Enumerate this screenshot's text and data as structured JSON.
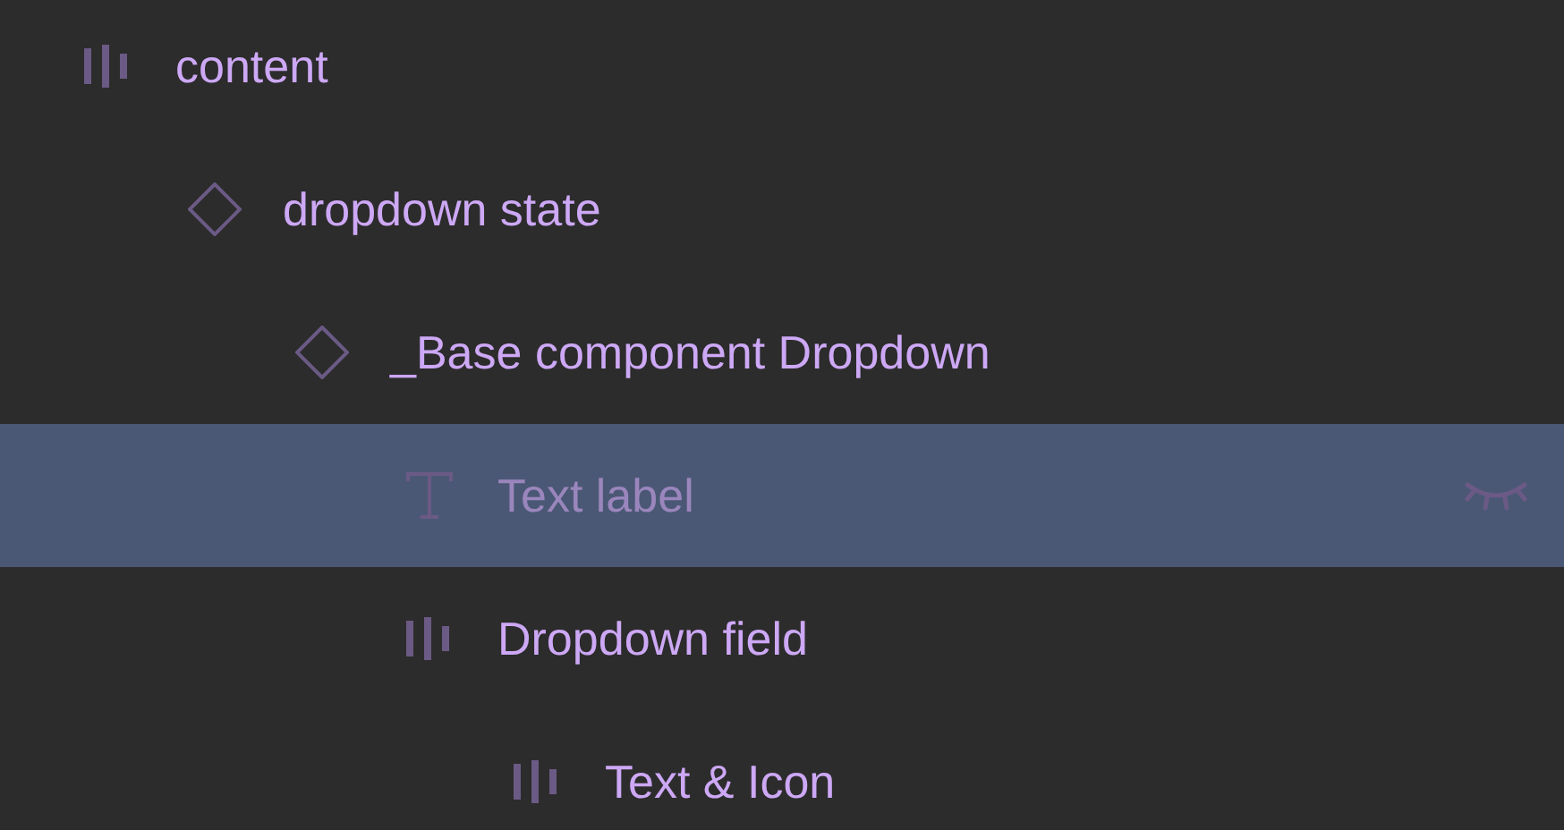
{
  "layers": [
    {
      "name": "content",
      "kind": "autolayout",
      "selected": false,
      "hidden": false,
      "children": [
        {
          "name": "dropdown state",
          "kind": "instance",
          "selected": false,
          "hidden": false,
          "children": [
            {
              "name": "_Base component Dropdown",
              "kind": "instance",
              "selected": false,
              "hidden": false,
              "children": [
                {
                  "name": "Text label",
                  "kind": "text",
                  "selected": true,
                  "hidden": true
                },
                {
                  "name": "Dropdown field",
                  "kind": "autolayout",
                  "selected": false,
                  "hidden": false,
                  "children": [
                    {
                      "name": "Text & Icon",
                      "kind": "autolayout",
                      "selected": false,
                      "hidden": false
                    }
                  ]
                }
              ]
            }
          ]
        }
      ]
    }
  ]
}
